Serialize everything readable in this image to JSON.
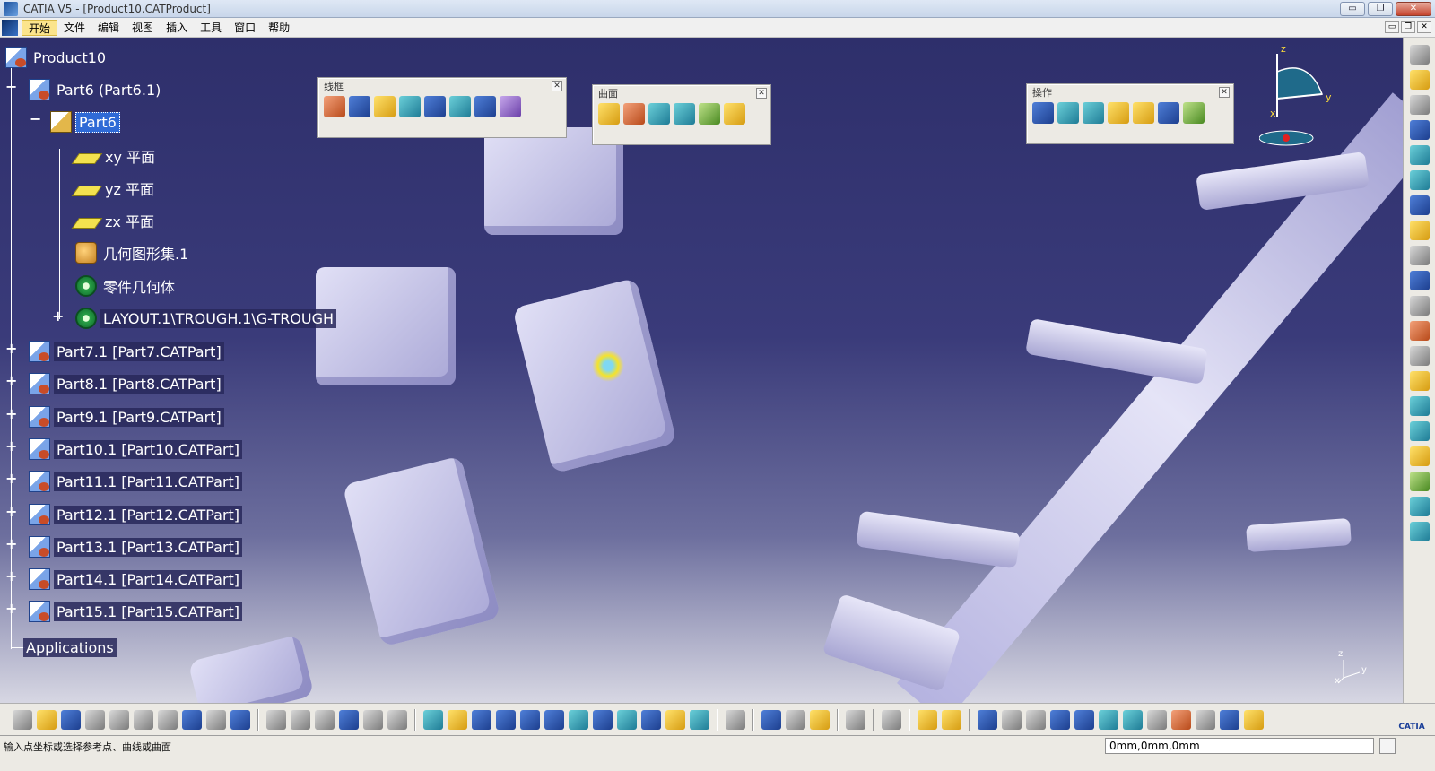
{
  "window": {
    "title": "CATIA V5 - [Product10.CATProduct]",
    "min": "▭",
    "restore": "❐",
    "close": "✕"
  },
  "menu": {
    "items": [
      "开始",
      "文件",
      "编辑",
      "视图",
      "插入",
      "工具",
      "窗口",
      "帮助"
    ]
  },
  "tree": {
    "root": "Product10",
    "part6": "Part6 (Part6.1)",
    "part6_body": "Part6",
    "xy": "xy 平面",
    "yz": "yz 平面",
    "zx": "zx 平面",
    "geoset": "几何图形集.1",
    "partbody": "零件几何体",
    "layout": "LAYOUT.1\\TROUGH.1\\G-TROUGH",
    "parts": [
      "Part7.1 [Part7.CATPart]",
      "Part8.1 [Part8.CATPart]",
      "Part9.1 [Part9.CATPart]",
      "Part10.1 [Part10.CATPart]",
      "Part11.1 [Part11.CATPart]",
      "Part12.1 [Part12.CATPart]",
      "Part13.1 [Part13.CATPart]",
      "Part14.1 [Part14.CATPart]",
      "Part15.1 [Part15.CATPart]"
    ],
    "applications": "Applications"
  },
  "toolbars": {
    "wireframe": "线框",
    "surfaces": "曲面",
    "operations": "操作"
  },
  "compass": {
    "z": "z",
    "y": "y",
    "x": "x"
  },
  "axes_mini": {
    "z": "z",
    "y": "y",
    "x": "x"
  },
  "status": {
    "message": "输入点坐标或选择参考点、曲线或曲面",
    "coordinates": "0mm,0mm,0mm"
  },
  "brand": "CATIA"
}
